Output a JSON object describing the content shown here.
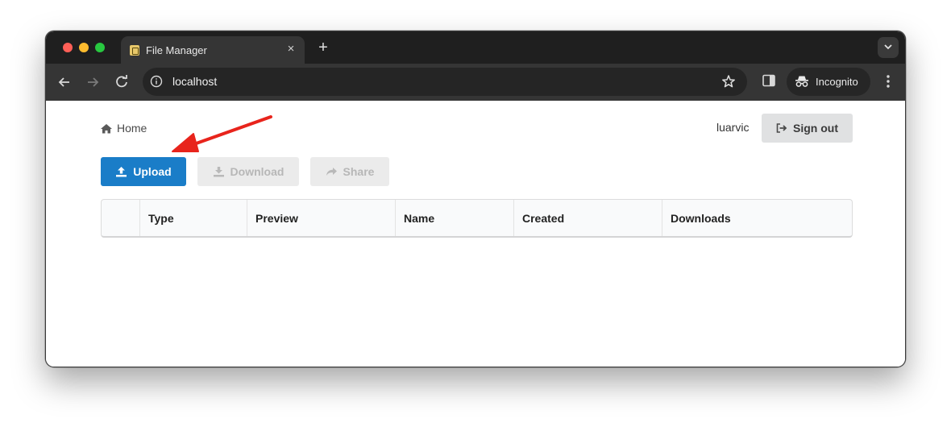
{
  "browser": {
    "tab_title": "File Manager",
    "tab_close": "×",
    "new_tab": "+",
    "url": "localhost",
    "incognito_label": "Incognito"
  },
  "page": {
    "breadcrumb": {
      "home_label": "Home"
    },
    "user": {
      "username": "luarvic",
      "signout_label": "Sign out"
    },
    "actions": {
      "upload_label": "Upload",
      "download_label": "Download",
      "share_label": "Share"
    },
    "table": {
      "columns": [
        "",
        "Type",
        "Preview",
        "Name",
        "Created",
        "Downloads"
      ]
    }
  },
  "colors": {
    "primary_button": "#1a7dc8",
    "disabled_button": "#ebebeb",
    "annotation_arrow": "#e8241c"
  },
  "icons": {
    "back": "arrow-left-icon",
    "forward": "arrow-right-icon",
    "reload": "reload-icon",
    "info": "info-icon",
    "star": "star-icon",
    "home": "home-icon",
    "signout": "sign-out-icon",
    "upload": "upload-icon",
    "download": "download-icon",
    "share": "share-icon"
  }
}
